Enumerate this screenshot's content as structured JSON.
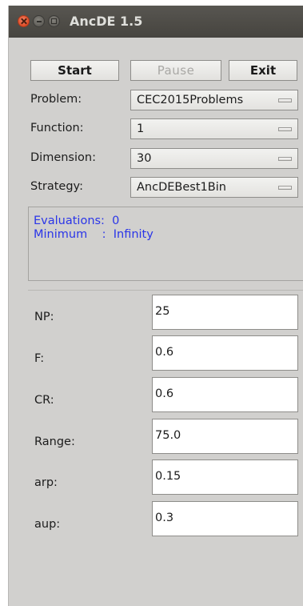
{
  "window": {
    "title": "AncDE 1.5"
  },
  "toolbar": {
    "start_label": "Start",
    "pause_label": "Pause",
    "exit_label": "Exit"
  },
  "settings": {
    "problem": {
      "label": "Problem:",
      "value": "CEC2015Problems"
    },
    "function": {
      "label": "Function:",
      "value": "1"
    },
    "dimension": {
      "label": "Dimension:",
      "value": "30"
    },
    "strategy": {
      "label": "Strategy:",
      "value": "AncDEBest1Bin"
    }
  },
  "status": {
    "evaluations_line": "Evaluations:  0",
    "minimum_line": "Minimum    :  Infinity",
    "color": "#2a35e8"
  },
  "params": [
    {
      "label": "NP:",
      "value": "25"
    },
    {
      "label": "F:",
      "value": "0.6"
    },
    {
      "label": "CR:",
      "value": "0.6"
    },
    {
      "label": "Range:",
      "value": "75.0"
    },
    {
      "label": "arp:",
      "value": "0.15"
    },
    {
      "label": "aup:",
      "value": "0.3"
    }
  ],
  "icons": {
    "close": "close-icon",
    "minimize": "minimize-icon",
    "maximize": "maximize-icon",
    "dropdown": "dropdown-arrow-icon"
  }
}
